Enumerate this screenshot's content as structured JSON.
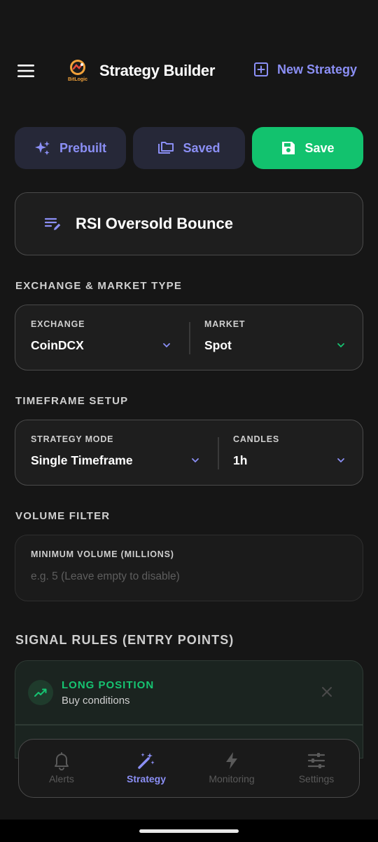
{
  "header": {
    "title": "Strategy Builder",
    "logo_text": "BitLogic",
    "new_strategy_label": "New Strategy"
  },
  "actions": {
    "prebuilt_label": "Prebuilt",
    "saved_label": "Saved",
    "save_label": "Save"
  },
  "strategy": {
    "name": "RSI Oversold Bounce"
  },
  "exchange_section": {
    "title": "EXCHANGE & MARKET TYPE",
    "exchange_label": "EXCHANGE",
    "exchange_value": "CoinDCX",
    "market_label": "MARKET",
    "market_value": "Spot"
  },
  "timeframe_section": {
    "title": "TIMEFRAME SETUP",
    "mode_label": "STRATEGY MODE",
    "mode_value": "Single Timeframe",
    "candles_label": "CANDLES",
    "candles_value": "1h"
  },
  "volume_section": {
    "title": "VOLUME FILTER",
    "min_volume_label": "MINIMUM VOLUME (MILLIONS)",
    "min_volume_placeholder": "e.g. 5 (Leave empty to disable)"
  },
  "signal_section": {
    "title": "SIGNAL RULES (ENTRY POINTS)",
    "long_title": "LONG POSITION",
    "long_subtitle": "Buy conditions"
  },
  "nav": {
    "items": [
      {
        "label": "Alerts",
        "icon": "bell-icon"
      },
      {
        "label": "Strategy",
        "icon": "magic-wand-icon",
        "active": true
      },
      {
        "label": "Monitoring",
        "icon": "lightning-icon"
      },
      {
        "label": "Settings",
        "icon": "sliders-icon"
      }
    ]
  },
  "colors": {
    "accent": "#8b8ff5",
    "save_green": "#12c26e",
    "long_green": "#16c472",
    "background": "#161616"
  }
}
